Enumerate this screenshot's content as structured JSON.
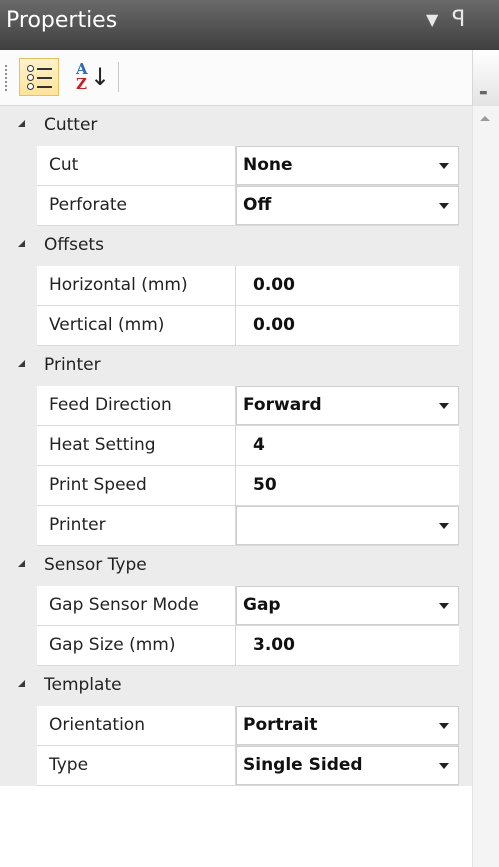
{
  "panel": {
    "title": "Properties",
    "menu_icon": "▼",
    "pin_icon": "ꟼ"
  },
  "toolbar": {
    "categorized_tooltip": "Categorized",
    "alphabetical_tooltip": "Alphabetical",
    "az_top": "A",
    "az_bottom": "Z",
    "az_arrow": "↓"
  },
  "categories": [
    {
      "label": "Cutter",
      "props": [
        {
          "name": "Cut",
          "value": "None",
          "dropdown": true
        },
        {
          "name": "Perforate",
          "value": "Off",
          "dropdown": true
        }
      ]
    },
    {
      "label": "Offsets",
      "props": [
        {
          "name": "Horizontal (mm)",
          "value": "0.00",
          "dropdown": false
        },
        {
          "name": "Vertical (mm)",
          "value": "0.00",
          "dropdown": false
        }
      ]
    },
    {
      "label": "Printer",
      "props": [
        {
          "name": "Feed Direction",
          "value": "Forward",
          "dropdown": true
        },
        {
          "name": "Heat Setting",
          "value": "4",
          "dropdown": false
        },
        {
          "name": "Print Speed",
          "value": "50",
          "dropdown": false
        },
        {
          "name": "Printer",
          "value": "",
          "dropdown": true
        }
      ]
    },
    {
      "label": "Sensor Type",
      "props": [
        {
          "name": "Gap Sensor Mode",
          "value": "Gap",
          "dropdown": true
        },
        {
          "name": "Gap Size (mm)",
          "value": "3.00",
          "dropdown": false
        }
      ]
    },
    {
      "label": "Template",
      "props": [
        {
          "name": "Orientation",
          "value": "Portrait",
          "dropdown": true
        },
        {
          "name": "Type",
          "value": "Single Sided",
          "dropdown": true
        }
      ]
    }
  ],
  "colors": {
    "title_bar": "#4f4f4f",
    "category_bg": "#ececec",
    "selected_tool": "#ffe39a"
  }
}
